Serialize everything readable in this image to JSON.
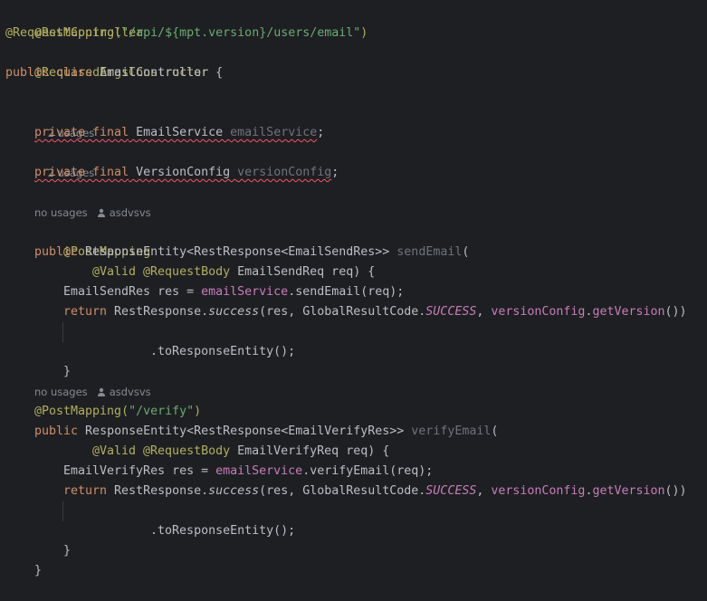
{
  "code": {
    "l1": "@RestController",
    "l2_ann": "@RequestMapping(",
    "l2_str": "\"/api/${mpt.version}/users/email\"",
    "l2_end": ")",
    "l3": "@RequiredArgsConstructor",
    "l4_kw": "public class",
    "l4_rest": " EmailController {",
    "usages_2": "2 usages",
    "field1_kw": "private final",
    "field1_type": " EmailService ",
    "field1_name": "emailService",
    "semi": ";",
    "field2_kw": "private final",
    "field2_type": " VersionConfig ",
    "field2_name": "versionConfig",
    "no_usages": "no usages",
    "author": "asdvsvs",
    "m1_ann": "@PostMapping",
    "m1_kw": "public",
    "m1_type": " ResponseEntity<RestResponse<EmailSendRes>> ",
    "m1_name": "sendEmail",
    "paren_open": "(",
    "m1_params_ann": "@Valid @RequestBody",
    "m1_params": " EmailSendReq req) {",
    "m1_b1_a": "EmailSendRes res = ",
    "svc": "emailService",
    "m1_b1_b": ".sendEmail(req);",
    "ret_kw": "return",
    "ret_a": " RestResponse.",
    "success": "success",
    "ret_b": "(res, GlobalResultCode.",
    "success_const": "SUCCESS",
    "comma": ", ",
    "vc": "versionConfig",
    "dot": ".",
    "get_version": "getVersion",
    "ret_c": "())",
    "to_response": ".toResponseEntity();",
    "close_brace": "}",
    "m2_ann": "@PostMapping(",
    "m2_str": "\"/verify\"",
    "m2_ann_end": ")",
    "m2_kw": "public",
    "m2_type": " ResponseEntity<RestResponse<EmailVerifyRes>> ",
    "m2_name": "verifyEmail",
    "m2_params_ann": "@Valid @RequestBody",
    "m2_params": " EmailVerifyReq req) {",
    "m2_b1_a": "EmailVerifyRes res = ",
    "m2_b1_b": ".verifyEmail(req);"
  }
}
